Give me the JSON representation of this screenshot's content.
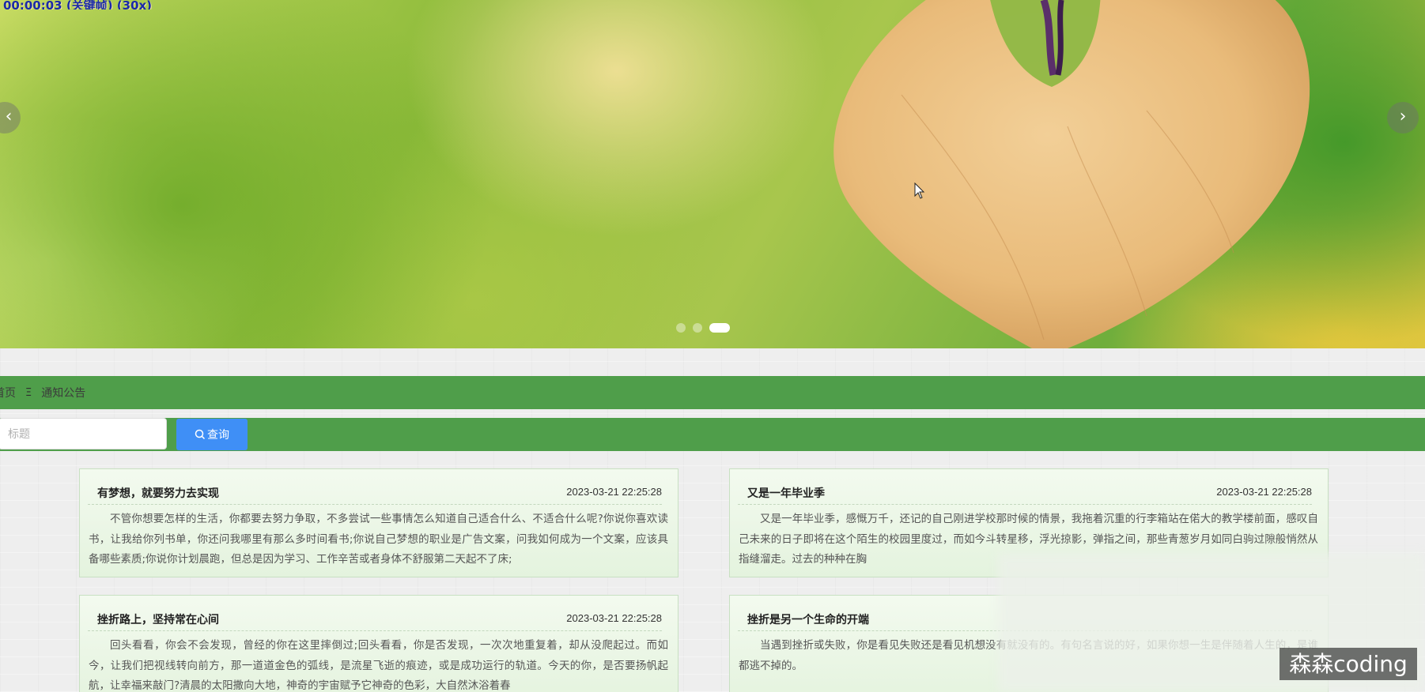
{
  "carousel": {
    "status_text": "00:00:03 (关键帧) (30x)",
    "prev_label": "‹",
    "next_label": "›",
    "dots": [
      {
        "active": false
      },
      {
        "active": false
      },
      {
        "active": true
      }
    ]
  },
  "breadcrumb": {
    "home": "首页",
    "separator": "Ξ",
    "current": "通知公告"
  },
  "search": {
    "placeholder": "标题",
    "button_label": "查询",
    "button_icon": "search-icon"
  },
  "news": [
    {
      "title": "有梦想，就要努力去实现",
      "date": "2023-03-21 22:25:28",
      "excerpt": "不管你想要怎样的生活，你都要去努力争取，不多尝试一些事情怎么知道自己适合什么、不适合什么呢?你说你喜欢读书，让我给你列书单，你还问我哪里有那么多时间看书;你说自己梦想的职业是广告文案，问我如何成为一个文案，应该具备哪些素质;你说你计划晨跑，但总是因为学习、工作辛苦或者身体不舒服第二天起不了床;"
    },
    {
      "title": "又是一年毕业季",
      "date": "2023-03-21 22:25:28",
      "excerpt": "又是一年毕业季，感慨万千，还记的自己刚进学校那时候的情景，我拖着沉重的行李箱站在偌大的教学楼前面，感叹自己未来的日子即将在这个陌生的校园里度过，而如今斗转星移，浮光掠影，弹指之间，那些青葱岁月如同白驹过隙般悄然从指缝溜走。过去的种种在胸"
    },
    {
      "title": "挫折路上，坚持常在心间",
      "date": "2023-03-21 22:25:28",
      "excerpt": "回头看看，你会不会发现，曾经的你在这里摔倒过;回头看看，你是否发现，一次次地重复着，却从没爬起过。而如今，让我们把视线转向前方，那一道道金色的弧线，是流星飞逝的痕迹，或是成功运行的轨道。今天的你，是否要扬帆起航，让幸福来敲门?清晨的太阳撒向大地，神奇的宇宙赋予它神奇的色彩，大自然沐浴着春"
    },
    {
      "title": "挫折是另一个生命的开端",
      "date": "",
      "excerpt": "当遇到挫折或失败，你是看见失败还是看见机想没有就没有的。有句名言说的好，如果你想一生是伴随着人生的，是谁都逃不掉的。"
    }
  ],
  "watermark": "森森coding",
  "colors": {
    "green_bar": "#4f9e4a",
    "search_button": "#3f8ff6",
    "card_background": "#eaf6e5"
  }
}
